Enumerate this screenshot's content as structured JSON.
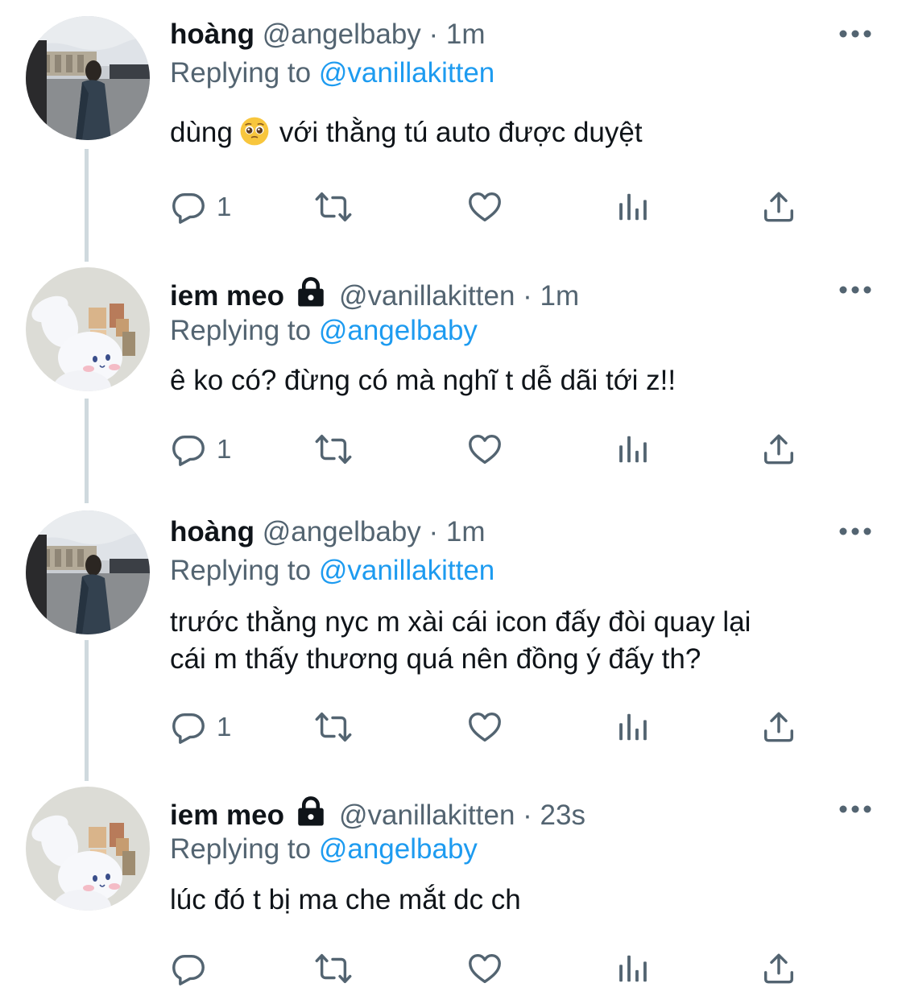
{
  "colors": {
    "text_primary": "#0f1419",
    "text_secondary": "#536471",
    "link": "#1d9bf0",
    "thread_line": "#cfd9de"
  },
  "tweets": [
    {
      "display_name": "hoàng",
      "locked": false,
      "handle": "@angelbaby",
      "dot": "·",
      "time": "1m",
      "replying_label": "Replying to",
      "reply_to": "@vanillakitten",
      "text_before_emoji": "dùng",
      "emoji": "pleading-face-emoji",
      "text_after_emoji": "với thằng tú auto được duyệt",
      "reply_count": "1",
      "avatar": "photo-person-in-plaza-avatar"
    },
    {
      "display_name": "iem meo",
      "locked": true,
      "handle": "@vanillakitten",
      "dot": "·",
      "time": "1m",
      "replying_label": "Replying to",
      "reply_to": "@angelbaby",
      "text": "ê ko có? đừng có mà nghĩ t dễ dãi tới z!!",
      "reply_count": "1",
      "avatar": "white-plush-bunny-avatar"
    },
    {
      "display_name": "hoàng",
      "locked": false,
      "handle": "@angelbaby",
      "dot": "·",
      "time": "1m",
      "replying_label": "Replying to",
      "reply_to": "@vanillakitten",
      "text_line1": "trước thằng nyc m xài cái icon đấy đòi quay lại",
      "text_line2": "cái m thấy thương quá nên đồng ý đấy th?",
      "reply_count": "1",
      "avatar": "photo-person-in-plaza-avatar"
    },
    {
      "display_name": "iem meo",
      "locked": true,
      "handle": "@vanillakitten",
      "dot": "·",
      "time": "23s",
      "replying_label": "Replying to",
      "reply_to": "@angelbaby",
      "text": "lúc đó t bị ma che mắt dc ch",
      "reply_count": "",
      "avatar": "white-plush-bunny-avatar"
    }
  ],
  "icons": {
    "reply": "reply-icon",
    "retweet": "retweet-icon",
    "like": "heart-icon",
    "views": "analytics-icon",
    "share": "share-icon",
    "more": "more-icon",
    "lock": "lock-icon"
  }
}
